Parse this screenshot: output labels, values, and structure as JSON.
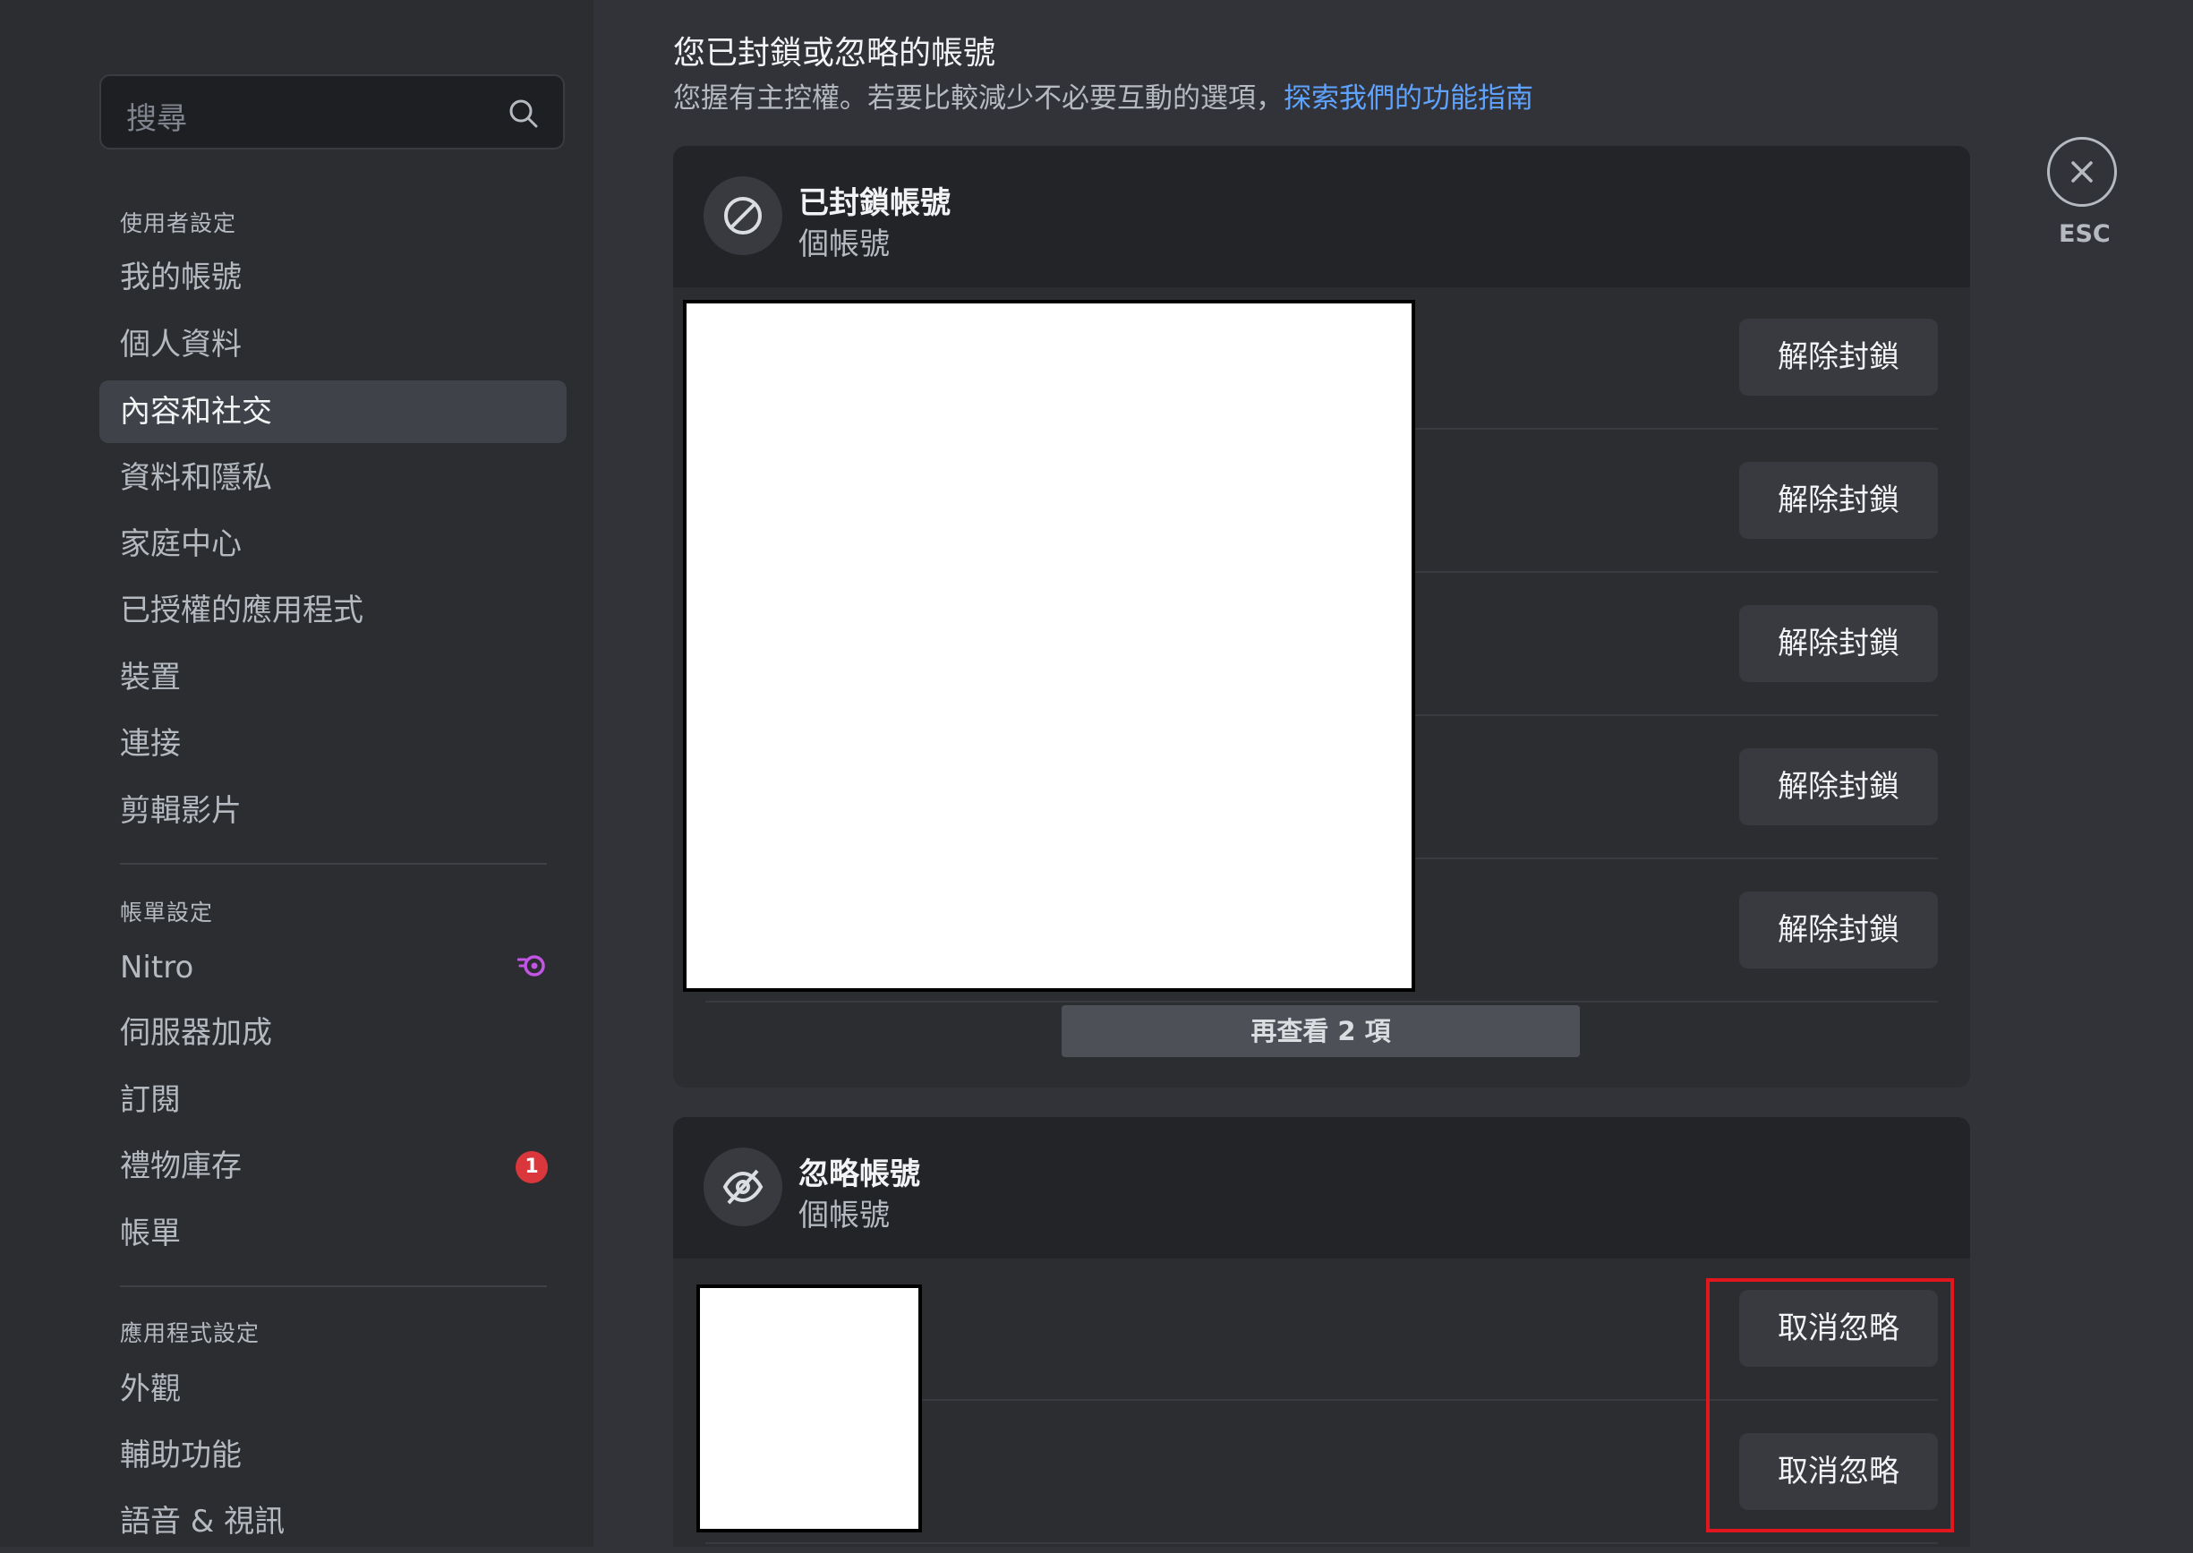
{
  "sidebar": {
    "search_placeholder": "搜尋",
    "sections": [
      {
        "header": "使用者設定",
        "items": [
          "我的帳號",
          "個人資料",
          "內容和社交",
          "資料和隱私",
          "家庭中心",
          "已授權的應用程式",
          "裝置",
          "連接",
          "剪輯影片"
        ],
        "active": "內容和社交"
      },
      {
        "header": "帳單設定",
        "items": [
          "Nitro",
          "伺服器加成",
          "訂閱",
          "禮物庫存",
          "帳單"
        ],
        "gift_badge": "1"
      },
      {
        "header": "應用程式設定",
        "items": [
          "外觀",
          "輔助功能",
          "語音 & 視訊"
        ]
      }
    ]
  },
  "main": {
    "title": "您已封鎖或忽略的帳號",
    "subtitle": "您握有主控權。若要比較減少不必要互動的選項，",
    "subtitle_link": "探索我們的功能指南",
    "blocked": {
      "title": "已封鎖帳號",
      "count_label": "個帳號",
      "button_label": "解除封鎖",
      "more_label": "再查看 2 項"
    },
    "ignored": {
      "title": "忽略帳號",
      "count_label": "個帳號",
      "button_label": "取消忽略"
    }
  },
  "close": {
    "label": "ESC"
  },
  "colors": {
    "accent_link": "#5ea3ff",
    "badge": "#da373c",
    "nitro": "#c255e4",
    "highlight": "#e0171e"
  }
}
